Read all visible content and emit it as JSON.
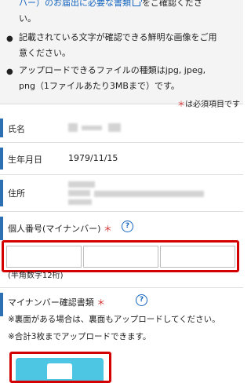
{
  "notes": {
    "line1_link": "バー）のお届出に必要な書類",
    "line1_rest": "をご確認くださ",
    "line2": "い。",
    "bullet2_a": "記載されている文字が確認できる鮮明な画像をご用",
    "bullet2_b": "意ください。",
    "bullet3_a": "アップロードできるファイルの種類はjpg, jpeg,",
    "bullet3_b": "png（1ファイルあたり3MBまで）です。",
    "bullet_glyph": "●"
  },
  "required_note": {
    "star": "＊",
    "text": "は必須項目です"
  },
  "fields": {
    "name_label": "氏名",
    "birthdate_label": "生年月日",
    "birthdate_value": "1979/11/15",
    "address_label": "住所"
  },
  "mynumber": {
    "label": "個人番号(マイナンバー)",
    "star": "＊",
    "help": "?",
    "hint": "(半角数字12桁)"
  },
  "confirm_docs": {
    "label": "マイナンバー確認書類",
    "star": "＊",
    "help": "?",
    "note1": "※裏面がある場合は、裏面もアップロードしてください。",
    "note2": "※合計3枚までアップロードできます。"
  },
  "colors": {
    "accent_bar": "#2c6fb3",
    "highlight": "#d40000",
    "link": "#1565c0",
    "upload": "#4cc6e2"
  }
}
